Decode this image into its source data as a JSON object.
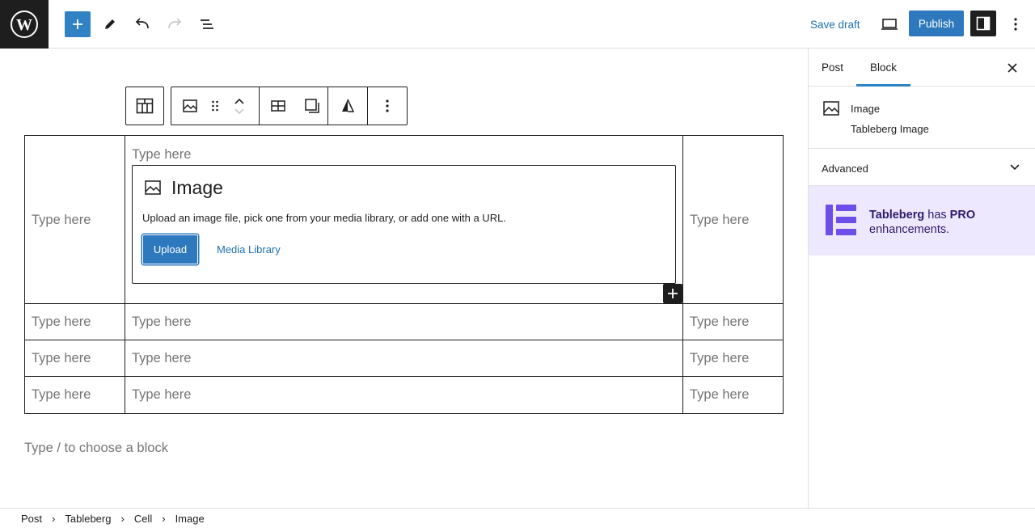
{
  "topbar": {
    "save_draft": "Save draft",
    "publish": "Publish"
  },
  "block_toolbar_icons": [
    "tableberg-cell-icon",
    "image-icon",
    "drag-handle-icon",
    "move-up-icon",
    "move-down-icon",
    "table-icon",
    "stack-icon",
    "tableberg-logo-icon",
    "more-options-icon"
  ],
  "table": {
    "placeholder": "Type here",
    "rows": [
      [
        "Type here",
        "Type here",
        "Type here"
      ],
      [
        "Type here",
        "Type here",
        "Type here"
      ],
      [
        "Type here",
        "Type here",
        "Type here"
      ],
      [
        "Type here",
        "Type here",
        "Type here"
      ]
    ]
  },
  "image_block": {
    "title": "Image",
    "description": "Upload an image file, pick one from your media library, or add one with a URL.",
    "upload": "Upload",
    "media_library": "Media Library"
  },
  "editor": {
    "choose_block": "Type / to choose a block"
  },
  "sidebar": {
    "tabs": [
      "Post",
      "Block"
    ],
    "active_tab": "Block",
    "block_title": "Image",
    "block_description": "Tableberg Image",
    "advanced": "Advanced",
    "promo_brand": "Tableberg",
    "promo_has": "has",
    "promo_pro": "PRO",
    "promo_enh": "enhancements."
  },
  "breadcrumb": [
    "Post",
    "Tableberg",
    "Cell",
    "Image"
  ],
  "colors": {
    "accent": "#3182c4",
    "publish": "#2e78bd",
    "promo_bg": "#ede8fd",
    "promo_logo": "#6d4ee8"
  }
}
